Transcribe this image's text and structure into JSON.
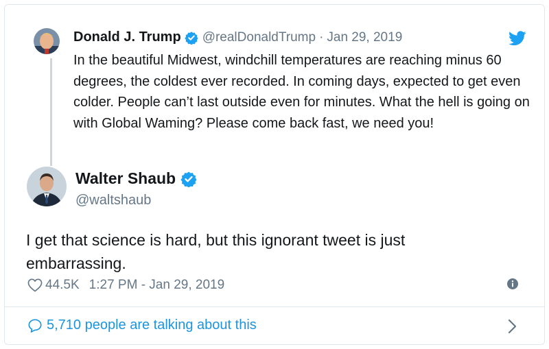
{
  "parent_tweet": {
    "name": "Donald J. Trump",
    "handle": "@realDonaldTrump",
    "separator": "·",
    "date": "Jan 29, 2019",
    "text": "In the beautiful Midwest, windchill temperatures are reaching minus 60 degrees, the coldest ever recorded. In coming days, expected to get even colder. People can’t last outside even for minutes. What the hell is going on with Global Waming? Please come back fast, we need you!",
    "avatar_icon": "user-avatar-photo",
    "verified_icon": "verified-badge-icon"
  },
  "main_tweet": {
    "name": "Walter Shaub",
    "handle": "@waltshaub",
    "text": "I get that science is hard, but this ignorant tweet is just embarrassing.",
    "likes": "44.5K",
    "timestamp": "1:27 PM - Jan 29, 2019",
    "avatar_icon": "user-avatar-photo",
    "verified_icon": "verified-badge-icon"
  },
  "footer": {
    "talking_label": "5,710 people are talking about this"
  },
  "colors": {
    "accent": "#1da1f2",
    "link": "#1b95e0",
    "secondary_text": "#657786",
    "border": "#e1e8ed"
  }
}
